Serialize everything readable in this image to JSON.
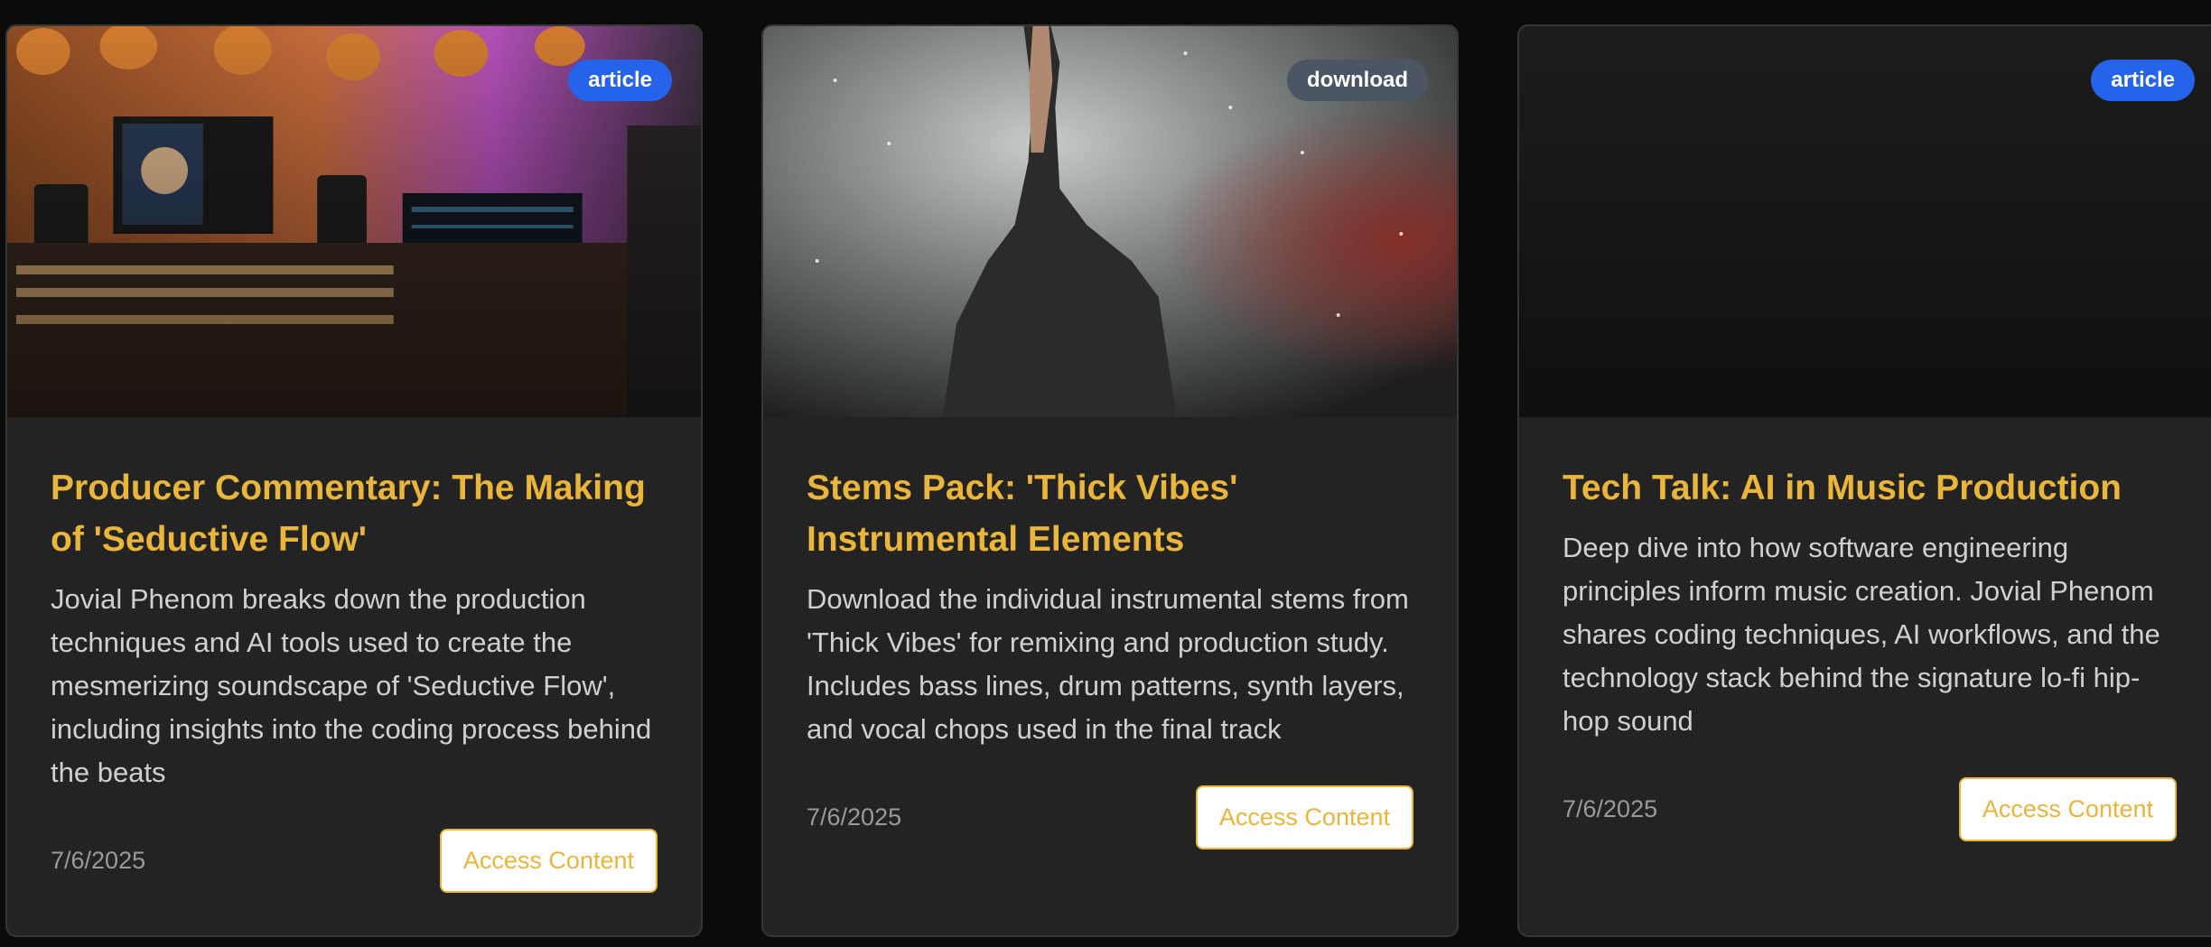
{
  "cards": [
    {
      "badge": "article",
      "image": "recording-studio-image",
      "title": "Producer Commentary: The Making of 'Seductive Flow'",
      "description": "Jovial Phenom breaks down the production techniques and AI tools used to create the mesmerizing soundscape of 'Seductive Flow', including insights into the coding process behind the beats",
      "date": "7/6/2025",
      "button": "Access Content"
    },
    {
      "badge": "download",
      "image": "performer-on-stage-image",
      "title": "Stems Pack: 'Thick Vibes' Instrumental Elements",
      "description": "Download the individual instrumental stems from 'Thick Vibes' for remixing and production study. Includes bass lines, drum patterns, synth layers, and vocal chops used in the final track",
      "date": "7/6/2025",
      "button": "Access Content"
    },
    {
      "badge": "article",
      "image": "dark-placeholder-image",
      "title": "Tech Talk: AI in Music Production",
      "description": "Deep dive into how software engineering principles inform music creation. Jovial Phenom shares coding techniques, AI workflows, and the technology stack behind the signature lo-fi hip-hop sound",
      "date": "7/6/2025",
      "button": "Access Content"
    }
  ],
  "colors": {
    "accent": "#e9b53a",
    "badge_article": "#2563eb",
    "badge_download": "#4b5563",
    "card_bg": "#232323",
    "page_bg": "#0b0b0b"
  }
}
